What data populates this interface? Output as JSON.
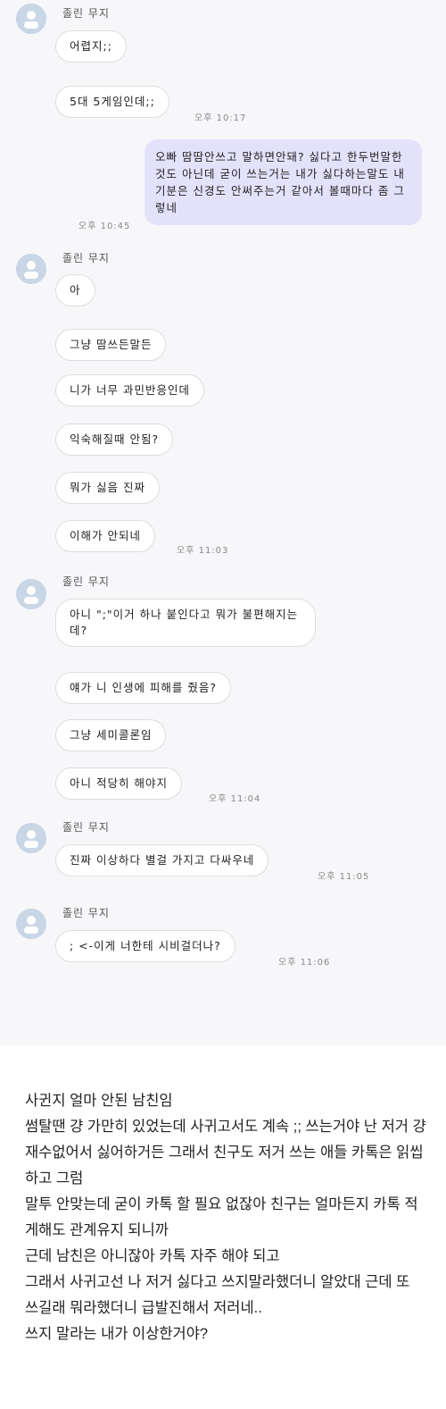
{
  "colors": {
    "my_bubble": "#e4e2fb",
    "their_bubble": "#ffffff",
    "avatar": "#c9d6e6"
  },
  "chat": {
    "group1": {
      "sender": "졸린 무지",
      "messages": [
        "어렵지;;",
        "5대 5게임인데;;"
      ],
      "time": "오후 10:17"
    },
    "mine": {
      "text": "오빠 땀땀안쓰고 말하면안돼? 싫다고 한두번말한것도 아닌데 굳이 쓰는거는 내가 싫다하는말도 내기분은 신경도 안써주는거 같아서 볼때마다 좀 그렇네",
      "time": "오후 10:45"
    },
    "group2": {
      "sender": "졸린 무지",
      "messages": [
        "아",
        "그냥 땀쓰든말든",
        "니가 너무 과민반응인데",
        "익숙해질때 안됨?",
        "뭐가 싫음 진짜",
        "이해가 안되네"
      ],
      "time": "오후 11:03"
    },
    "group3": {
      "sender": "졸린 무지",
      "messages": [
        "아니 \";\"이거 하나 붙인다고 뭐가 불편해지는데?",
        "얘가 니 인생에 피해를 줬음?",
        "그냥 세미콜론임",
        "아니 적당히 해야지"
      ],
      "time": "오후 11:04"
    },
    "group4": {
      "sender": "졸린 무지",
      "messages": [
        "진짜 이상하다 별걸 가지고 다싸우네"
      ],
      "time": "오후 11:05"
    },
    "group5": {
      "sender": "졸린 무지",
      "messages": [
        "; <-이게 너한테 시비걸더나?"
      ],
      "time": "오후 11:06"
    }
  },
  "post": {
    "text": "사귄지 얼마 안된 남친임\n썸탈땐 걍 가만히 있었는데 사귀고서도 계속 ;; 쓰는거야 난 저거 걍 재수없어서 싫어하거든 그래서 친구도 저거 쓰는 애들 카톡은 읽씹하고 그럼\n말투 안맞는데 굳이 카톡 할 필요 없잖아 친구는 얼마든지 카톡 적게해도 관계유지 되니까\n근데 남친은 아니잖아 카톡 자주 해야 되고\n그래서 사귀고선 나 저거 싫다고 쓰지말라했더니 알았대 근데 또 쓰길래 뭐라했더니 급발진해서 저러네..\n쓰지 말라는 내가 이상한거야?"
  }
}
